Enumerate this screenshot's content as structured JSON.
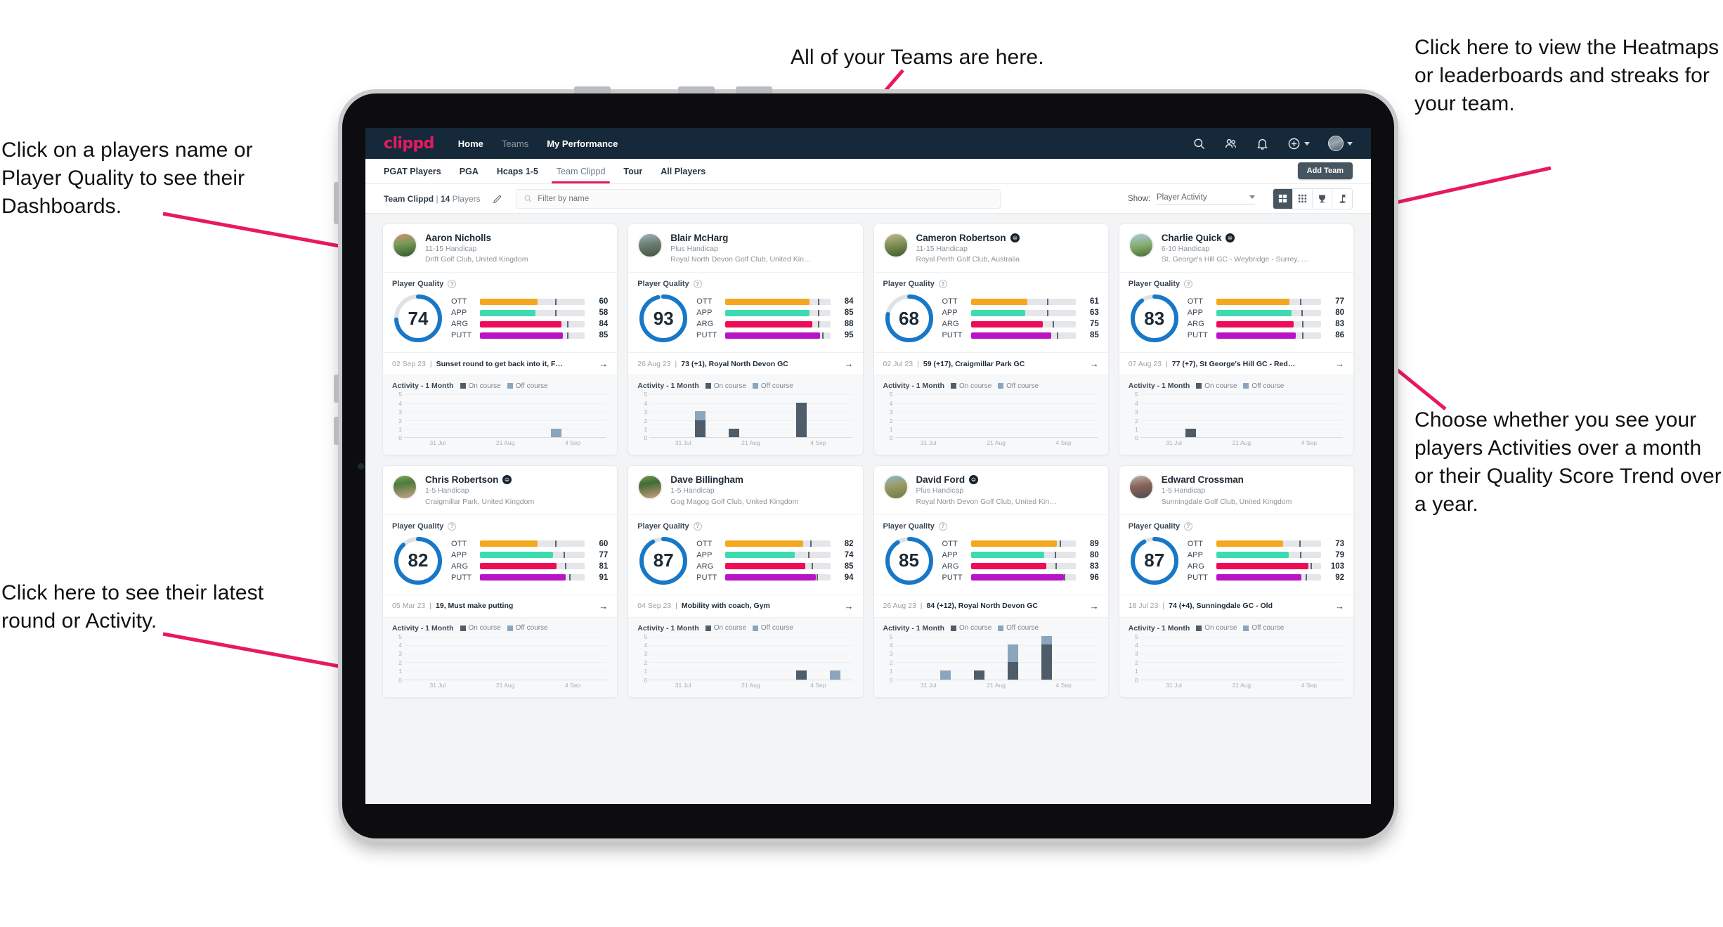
{
  "annotations": {
    "top_left": "Click on a players name or Player Quality to see their Dashboards.",
    "top_center": "All of your Teams are here.",
    "top_right": "Click here to view the Heatmaps or leaderboards and streaks for your team.",
    "right_middle": "Choose whether you see your players Activities over a month or their Quality Score Trend over a year.",
    "bottom_left": "Click here to see their latest round or Activity.",
    "arrow_color": "#e8195f"
  },
  "navbar": {
    "logo": "clippd",
    "links": [
      {
        "label": "Home",
        "active": true
      },
      {
        "label": "Teams",
        "active": false
      },
      {
        "label": "My Performance",
        "active": true
      }
    ],
    "icons": [
      "search-icon",
      "people-icon",
      "bell-icon",
      "plus-circle-icon",
      "avatar"
    ]
  },
  "tabs": [
    {
      "label": "PGAT Players",
      "active": false
    },
    {
      "label": "PGA",
      "active": false
    },
    {
      "label": "Hcaps 1-5",
      "active": false
    },
    {
      "label": "Team Clippd",
      "active": true
    },
    {
      "label": "Tour",
      "active": false
    },
    {
      "label": "All Players",
      "active": false
    }
  ],
  "add_team_label": "Add Team",
  "toolbar": {
    "team_name": "Team Clippd",
    "separator": "|",
    "player_count": "14",
    "players_word": "Players",
    "edit_icon": "pencil-icon",
    "search_placeholder": "Filter by name",
    "show_label": "Show:",
    "show_value": "Player Activity",
    "show_options": [
      "Player Activity",
      "Quality Score Trend"
    ],
    "view_buttons": [
      {
        "name": "grid-view",
        "active": true
      },
      {
        "name": "dense-grid-view",
        "active": false
      },
      {
        "name": "leaderboard-trophy-view",
        "active": false
      },
      {
        "name": "heatmap-flag-view",
        "active": false
      }
    ]
  },
  "card_labels": {
    "player_quality": "Player Quality",
    "help": "?",
    "activity": "Activity - 1 Month",
    "legend_on": "On course",
    "legend_off": "Off course",
    "arrow": "→"
  },
  "metric_colors": {
    "OTT": "#f5a81c",
    "APP": "#3ddbb0",
    "ARG": "#ef0b56",
    "PUTT": "#b813c6",
    "ring": "#1878c8",
    "ring_track": "#dfe2e5",
    "on_course": "#4e5d69",
    "off_course": "#8ba5bd"
  },
  "chart_data": {
    "type": "bar",
    "title": "Activity - 1 Month",
    "ylabel": "",
    "xlabel": "",
    "ylim": [
      0,
      5
    ],
    "yticks": [
      0,
      1,
      2,
      3,
      4,
      5
    ],
    "xticks": [
      "31 Jul",
      "21 Aug",
      "4 Sep"
    ],
    "grid": true,
    "legend": [
      "On course",
      "Off course"
    ],
    "stacked": true,
    "panels": [
      {
        "player": "Aaron Nicholls",
        "bars": [
          [
            0,
            0
          ],
          [
            0,
            0
          ],
          [
            0,
            0
          ],
          [
            0,
            0
          ],
          [
            0,
            1
          ],
          [
            0,
            0
          ]
        ]
      },
      {
        "player": "Blair McHarg",
        "bars": [
          [
            0,
            0
          ],
          [
            2,
            1
          ],
          [
            1,
            0
          ],
          [
            0,
            0
          ],
          [
            4,
            0
          ],
          [
            0,
            0
          ]
        ]
      },
      {
        "player": "Cameron Robertson",
        "bars": [
          [
            0,
            0
          ],
          [
            0,
            0
          ],
          [
            0,
            0
          ],
          [
            0,
            0
          ],
          [
            0,
            0
          ],
          [
            0,
            0
          ]
        ]
      },
      {
        "player": "Charlie Quick",
        "bars": [
          [
            0,
            0
          ],
          [
            1,
            0
          ],
          [
            0,
            0
          ],
          [
            0,
            0
          ],
          [
            0,
            0
          ],
          [
            0,
            0
          ]
        ]
      },
      {
        "player": "Chris Robertson",
        "bars": [
          [
            0,
            0
          ],
          [
            0,
            0
          ],
          [
            0,
            0
          ],
          [
            0,
            0
          ],
          [
            0,
            0
          ],
          [
            0,
            0
          ]
        ]
      },
      {
        "player": "Dave Billingham",
        "bars": [
          [
            0,
            0
          ],
          [
            0,
            0
          ],
          [
            0,
            0
          ],
          [
            0,
            0
          ],
          [
            1,
            0
          ],
          [
            0,
            1
          ]
        ]
      },
      {
        "player": "David Ford",
        "bars": [
          [
            0,
            0
          ],
          [
            0,
            1
          ],
          [
            1,
            0
          ],
          [
            2,
            2
          ],
          [
            4,
            1
          ],
          [
            0,
            0
          ]
        ]
      },
      {
        "player": "Edward Crossman",
        "bars": [
          [
            0,
            0
          ],
          [
            0,
            0
          ],
          [
            0,
            0
          ],
          [
            0,
            0
          ],
          [
            0,
            0
          ],
          [
            0,
            0
          ]
        ]
      }
    ]
  },
  "players": [
    {
      "name": "Aaron Nicholls",
      "verified": false,
      "handicap": "11-15 Handicap",
      "club": "Drift Golf Club, United Kingdom",
      "quality": 74,
      "ring_pct": 74,
      "metrics": [
        {
          "label": "OTT",
          "value": 60,
          "fill": 55,
          "tick": 72
        },
        {
          "label": "APP",
          "value": 58,
          "fill": 53,
          "tick": 72
        },
        {
          "label": "ARG",
          "value": 84,
          "fill": 78,
          "tick": 83
        },
        {
          "label": "PUTT",
          "value": 85,
          "fill": 79,
          "tick": 83
        }
      ],
      "latest_date": "02 Sep 23",
      "latest_text": "Sunset round to get back into it, F…",
      "avatar": "linear-gradient(170deg,#d98b6a 0%,#7d9b5a 40%,#2f5a2a 100%)"
    },
    {
      "name": "Blair McHarg",
      "verified": false,
      "handicap": "Plus Handicap",
      "club": "Royal North Devon Golf Club, United Kin…",
      "quality": 93,
      "ring_pct": 96,
      "metrics": [
        {
          "label": "OTT",
          "value": 84,
          "fill": 80,
          "tick": 88
        },
        {
          "label": "APP",
          "value": 85,
          "fill": 80,
          "tick": 88
        },
        {
          "label": "ARG",
          "value": 88,
          "fill": 83,
          "tick": 88
        },
        {
          "label": "PUTT",
          "value": 95,
          "fill": 90,
          "tick": 92
        }
      ],
      "latest_date": "26 Aug 23",
      "latest_text": "73 (+1), Royal North Devon GC",
      "avatar": "linear-gradient(170deg,#9fb3c0 0%,#6d7f72 45%,#44513f 100%)"
    },
    {
      "name": "Cameron Robertson",
      "verified": true,
      "handicap": "11-15 Handicap",
      "club": "Royal Perth Golf Club, Australia",
      "quality": 68,
      "ring_pct": 78,
      "metrics": [
        {
          "label": "OTT",
          "value": 61,
          "fill": 54,
          "tick": 73
        },
        {
          "label": "APP",
          "value": 63,
          "fill": 52,
          "tick": 73
        },
        {
          "label": "ARG",
          "value": 75,
          "fill": 69,
          "tick": 78
        },
        {
          "label": "PUTT",
          "value": 85,
          "fill": 77,
          "tick": 82
        }
      ],
      "latest_date": "02 Jul 23",
      "latest_text": "59 (+17), Craigmillar Park GC",
      "avatar": "linear-gradient(170deg,#c9b98e 0%,#7f9156 45%,#3e5a2c 100%)"
    },
    {
      "name": "Charlie Quick",
      "verified": true,
      "handicap": "6-10 Handicap",
      "club": "St. George's Hill GC - Weybridge - Surrey, …",
      "quality": 83,
      "ring_pct": 90,
      "metrics": [
        {
          "label": "OTT",
          "value": 77,
          "fill": 70,
          "tick": 80
        },
        {
          "label": "APP",
          "value": 80,
          "fill": 72,
          "tick": 81
        },
        {
          "label": "ARG",
          "value": 83,
          "fill": 74,
          "tick": 82
        },
        {
          "label": "PUTT",
          "value": 86,
          "fill": 76,
          "tick": 82
        }
      ],
      "latest_date": "07 Aug 23",
      "latest_text": "77 (+7), St George's Hill GC - Red…",
      "avatar": "linear-gradient(170deg,#a9cbe4 0%,#87ad6e 50%,#4a6b38 100%)"
    },
    {
      "name": "Chris Robertson",
      "verified": true,
      "handicap": "1-5 Handicap",
      "club": "Craigmillar Park, United Kingdom",
      "quality": 82,
      "ring_pct": 88,
      "metrics": [
        {
          "label": "OTT",
          "value": 60,
          "fill": 55,
          "tick": 72
        },
        {
          "label": "APP",
          "value": 77,
          "fill": 70,
          "tick": 80
        },
        {
          "label": "ARG",
          "value": 81,
          "fill": 73,
          "tick": 81
        },
        {
          "label": "PUTT",
          "value": 91,
          "fill": 82,
          "tick": 85
        }
      ],
      "latest_date": "05 Mar 23",
      "latest_text": "19, Must make putting",
      "avatar": "linear-gradient(170deg,#79a95e 0%,#4e7b3c 35%,#c9a288 100%)"
    },
    {
      "name": "Dave Billingham",
      "verified": false,
      "handicap": "1-5 Handicap",
      "club": "Gog Magog Golf Club, United Kingdom",
      "quality": 87,
      "ring_pct": 92,
      "metrics": [
        {
          "label": "OTT",
          "value": 82,
          "fill": 74,
          "tick": 81
        },
        {
          "label": "APP",
          "value": 74,
          "fill": 66,
          "tick": 79
        },
        {
          "label": "ARG",
          "value": 85,
          "fill": 76,
          "tick": 82
        },
        {
          "label": "PUTT",
          "value": 94,
          "fill": 86,
          "tick": 87
        }
      ],
      "latest_date": "04 Sep 23",
      "latest_text": "Mobility with coach, Gym",
      "avatar": "linear-gradient(170deg,#6f9a55 0%,#426b33 35%,#cf9f81 100%)"
    },
    {
      "name": "David Ford",
      "verified": true,
      "handicap": "Plus Handicap",
      "club": "Royal North Devon Golf Club, United Kin…",
      "quality": 85,
      "ring_pct": 91,
      "metrics": [
        {
          "label": "OTT",
          "value": 89,
          "fill": 82,
          "tick": 85
        },
        {
          "label": "APP",
          "value": 80,
          "fill": 70,
          "tick": 80
        },
        {
          "label": "ARG",
          "value": 83,
          "fill": 72,
          "tick": 81
        },
        {
          "label": "PUTT",
          "value": 96,
          "fill": 89,
          "tick": 89
        }
      ],
      "latest_date": "26 Aug 23",
      "latest_text": "84 (+12), Royal North Devon GC",
      "avatar": "linear-gradient(170deg,#8fb7cf 0%,#9c9a62 45%,#6e7a4a 100%)"
    },
    {
      "name": "Edward Crossman",
      "verified": false,
      "handicap": "1-5 Handicap",
      "club": "Sunningdale Golf Club, United Kingdom",
      "quality": 87,
      "ring_pct": 92,
      "metrics": [
        {
          "label": "OTT",
          "value": 73,
          "fill": 64,
          "tick": 79
        },
        {
          "label": "APP",
          "value": 79,
          "fill": 69,
          "tick": 80
        },
        {
          "label": "ARG",
          "value": 103,
          "fill": 88,
          "tick": 90
        },
        {
          "label": "PUTT",
          "value": 92,
          "fill": 81,
          "tick": 85
        }
      ],
      "latest_date": "18 Jul 23",
      "latest_text": "74 (+4), Sunningdale GC - Old",
      "avatar": "linear-gradient(170deg,#b9b4ae 0%,#8a6257 45%,#4b4a52 100%)"
    }
  ]
}
